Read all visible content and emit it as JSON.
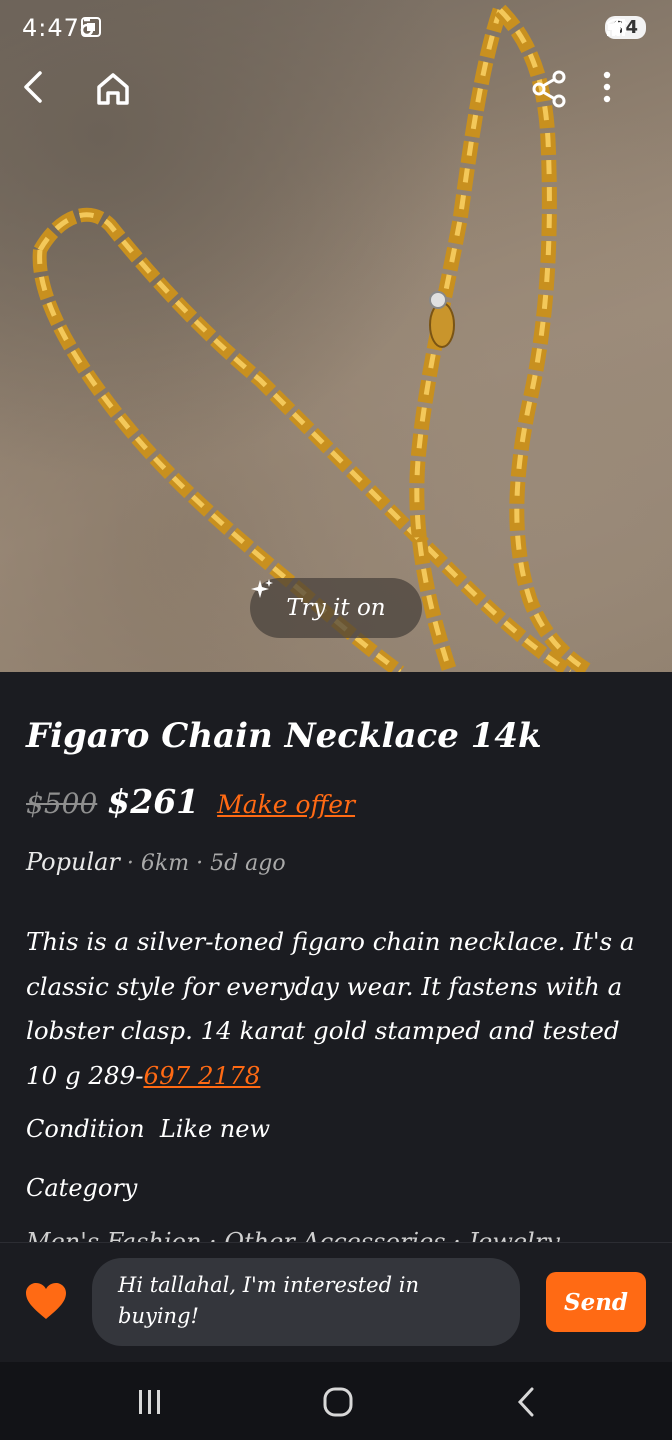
{
  "status_bar": {
    "time": "4:47",
    "battery": "94"
  },
  "hero": {
    "try_it_on_label": "Try it on"
  },
  "listing": {
    "title": "Figaro Chain Necklace 14k",
    "original_price": "$500",
    "price": "$261",
    "make_offer_label": "Make offer",
    "popularity": "Popular",
    "distance": "6km",
    "posted": "5d ago",
    "description_text": "This is a silver-toned figaro chain necklace. It's a classic style for everyday wear. It fastens with a lobster clasp. 14 karat gold stamped and tested 10 g 289-",
    "description_link": "697 2178",
    "condition_label": "Condition",
    "condition_value": "Like new",
    "category_label": "Category",
    "category_path": "Men's Fashion · Other Accessories · Jewelry"
  },
  "message": {
    "text": "Hi tallahal, I'm interested in buying!",
    "send_label": "Send"
  },
  "colors": {
    "accent": "#ff6a14",
    "background": "#1b1c21",
    "input_bg": "#34363c"
  },
  "icons": {
    "back": "back-arrow-icon",
    "home": "home-icon",
    "share": "share-icon",
    "more": "more-vertical-icon",
    "sparkle": "sparkle-icon",
    "heart": "heart-icon"
  }
}
